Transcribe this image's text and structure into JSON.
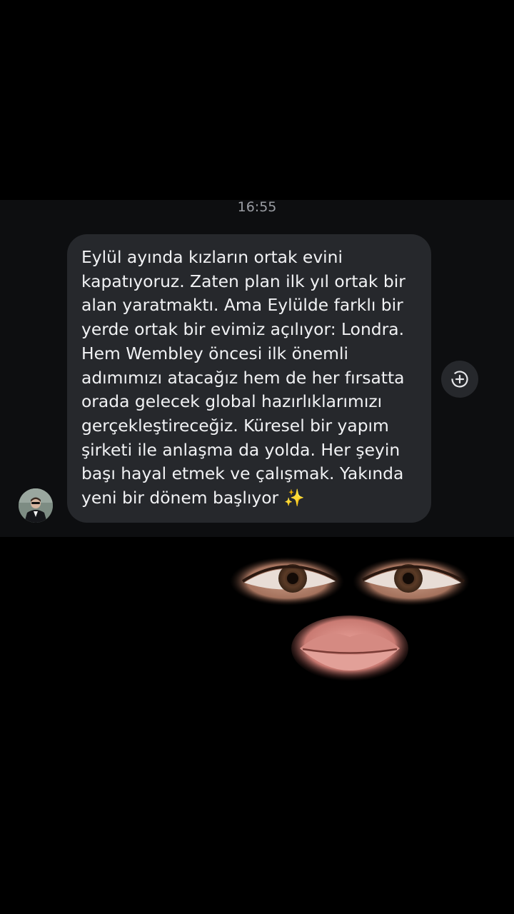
{
  "chat": {
    "timestamp": "16:55",
    "message": {
      "text": "Eylül ayında kızların ortak evini\nkapatıyoruz. Zaten plan ilk yıl ortak bir\nalan yaratmaktı. Ama Eylülde farklı bir\nyerde ortak bir evimiz açılıyor: Londra.\nHem Wembley öncesi ilk önemli\nadımımızı atacağız hem de her fırsatta\norada gelecek global hazırlıklarımızı\ngerçekleştireceğiz. Küresel bir yapım\nşirketi ile anlaşma da yolda. Her şeyin\nbaşı hayal etmek ve çalışmak. Yakında\nyeni bir dönem başlıyor ✨",
      "bubble_color": "#26282c",
      "text_color": "#f1f2f4"
    },
    "react_button": {
      "icon": "add-reaction-icon"
    },
    "avatar": {
      "icon": "user-avatar"
    }
  },
  "overlay": {
    "icon": "eyes-and-lips-face"
  },
  "colors": {
    "background": "#000000",
    "chat_panel": "#0d0e10",
    "timestamp": "#9a9da3"
  }
}
